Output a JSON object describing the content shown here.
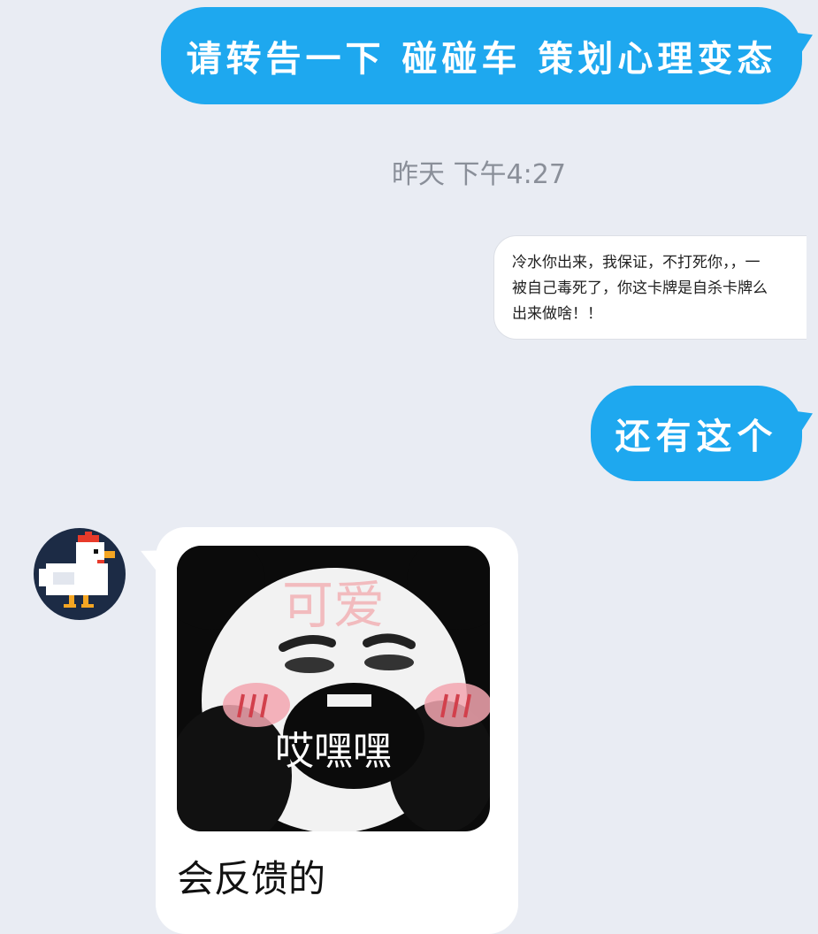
{
  "messages": {
    "outgoing_1": "请转告一下 碰碰车 策划心理变态",
    "timestamp": "昨天 下午4:27",
    "quoted_card": {
      "line1": "冷水你出来，我保证，不打死你，，一",
      "line2": "被自己毒死了，你这卡牌是自杀卡牌么",
      "line3": "出来做啥！！"
    },
    "outgoing_2": "还有这个",
    "incoming": {
      "avatar_icon": "pixel-chicken-icon",
      "sticker": {
        "top_text": "可爱",
        "caption": "哎嘿嘿"
      },
      "text": "会反馈的"
    }
  },
  "colors": {
    "background": "#e9ecf3",
    "outgoing_bubble": "#1ea8ef",
    "incoming_bubble": "#ffffff",
    "timestamp": "#8a8f99"
  }
}
